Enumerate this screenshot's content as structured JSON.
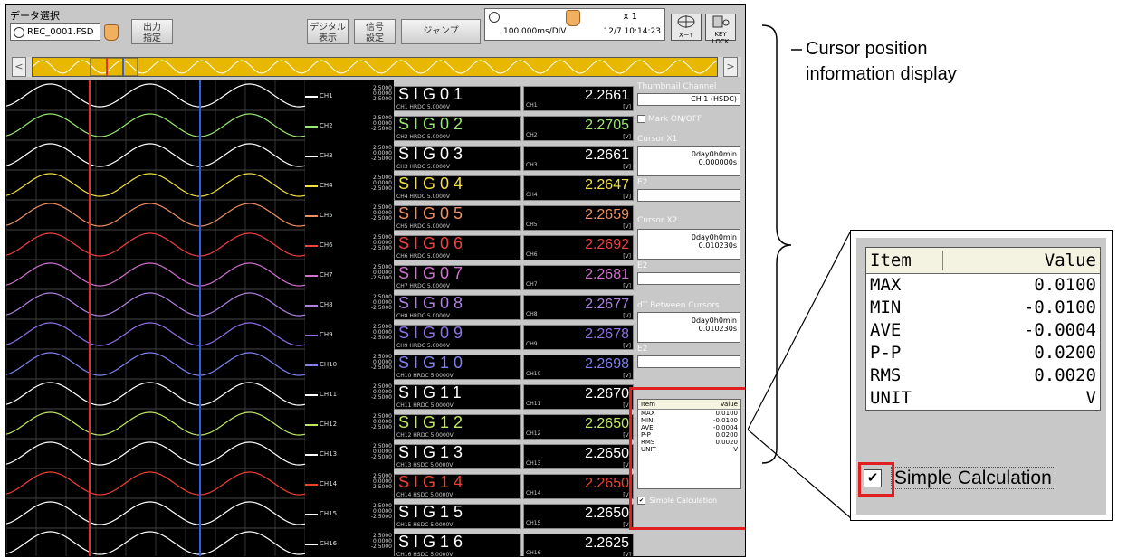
{
  "topbar": {
    "data_select_label": "データ選択",
    "file_name": "REC_0001.FSD",
    "output_btn": "出力\n指定",
    "digital_btn": "デジタル\n表示",
    "signal_btn": "信号\n設定",
    "jump_btn": "ジャンプ",
    "zoom_value": "x 1",
    "time_div": "100.000ms/DIV",
    "datetime": "12/7 10:14:23",
    "xy_label": "X－Y",
    "keylock_label": "KEY LOCK"
  },
  "channels": [
    {
      "ch": "CH1",
      "name": "SIG01",
      "sub": "CH1 HRDC 5.0000V",
      "value": "2.2661",
      "color": "#ffffff",
      "scale": [
        "2.5000",
        "0.0000",
        "-2.5000"
      ]
    },
    {
      "ch": "CH2",
      "name": "SIG02",
      "sub": "CH2 HRDC 5.0000V",
      "value": "2.2705",
      "color": "#98e870",
      "scale": [
        "2.5000",
        "0.0000",
        "-2.5000"
      ]
    },
    {
      "ch": "CH3",
      "name": "SIG03",
      "sub": "CH3 HRDC 5.0000V",
      "value": "2.2661",
      "color": "#ffffff",
      "scale": [
        "2.5000",
        "0.0000",
        "-2.5000"
      ]
    },
    {
      "ch": "CH4",
      "name": "SIG04",
      "sub": "CH4 HRDC 5.0000V",
      "value": "2.2647",
      "color": "#f0e040",
      "scale": [
        "2.5000",
        "0.0000",
        "-2.5000"
      ]
    },
    {
      "ch": "CH5",
      "name": "SIG05",
      "sub": "CH5 HRDC 5.0000V",
      "value": "2.2659",
      "color": "#f09060",
      "scale": [
        "2.5000",
        "0.0000",
        "-2.5000"
      ]
    },
    {
      "ch": "CH6",
      "name": "SIG06",
      "sub": "CH6 HRDC 5.0000V",
      "value": "2.2692",
      "color": "#f04040",
      "scale": [
        "2.5000",
        "0.0000",
        "-2.5000"
      ]
    },
    {
      "ch": "CH7",
      "name": "SIG07",
      "sub": "CH7 HRDC 5.0000V",
      "value": "2.2681",
      "color": "#d070d0",
      "scale": [
        "2.5000",
        "0.0000",
        "-2.5000"
      ]
    },
    {
      "ch": "CH8",
      "name": "SIG08",
      "sub": "CH8 HRDC 5.0000V",
      "value": "2.2677",
      "color": "#b080e0",
      "scale": [
        "2.5000",
        "0.0000",
        "-2.5000"
      ]
    },
    {
      "ch": "CH9",
      "name": "SIG09",
      "sub": "CH9 HRDC 5.0000V",
      "value": "2.2678",
      "color": "#9070e8",
      "scale": [
        "2.5000",
        "0.0000",
        "-2.5000"
      ]
    },
    {
      "ch": "CH10",
      "name": "SIG10",
      "sub": "CH10 HRDC 5.0000V",
      "value": "2.2698",
      "color": "#8080f0",
      "scale": [
        "2.5000",
        "0.0000",
        "-2.5000"
      ]
    },
    {
      "ch": "CH11",
      "name": "SIG11",
      "sub": "CH11 HRDC 5.0000V",
      "value": "2.2670",
      "color": "#ffffff",
      "scale": [
        "2.5000",
        "0.0000",
        "-2.5000"
      ]
    },
    {
      "ch": "CH12",
      "name": "SIG12",
      "sub": "CH12 HRDC 5.0000V",
      "value": "2.2650",
      "color": "#c0e860",
      "scale": [
        "2.5000",
        "0.0000",
        "-2.5000"
      ]
    },
    {
      "ch": "CH13",
      "name": "SIG13",
      "sub": "CH13 HSDC 5.0000V",
      "value": "2.2650",
      "color": "#ffffff",
      "scale": [
        "2.5000",
        "0.0000",
        "-2.5000"
      ]
    },
    {
      "ch": "CH14",
      "name": "SIG14",
      "sub": "CH14 HSDC 5.0000V",
      "value": "2.2650",
      "color": "#f04030",
      "scale": [
        "2.5000",
        "0.0000",
        "-2.5000"
      ]
    },
    {
      "ch": "CH15",
      "name": "SIG15",
      "sub": "CH15 HSDC 5.0000V",
      "value": "2.2650",
      "color": "#ffffff",
      "scale": [
        "2.5000",
        "0.0000",
        "-2.5000"
      ]
    },
    {
      "ch": "CH16",
      "name": "SIG16",
      "sub": "CH16 HSDC 5.0000V",
      "value": "2.2625",
      "color": "#ffffff",
      "scale": [
        "2.5000",
        "0.0000",
        "-2.5000"
      ]
    }
  ],
  "right_panel": {
    "thumbnail_label": "Thumbnail Channel",
    "thumbnail_value": "CH 1 (HSDC)",
    "mark_label": "Mark ON/OFF",
    "cursor1_label": "Cursor X1",
    "cursor1_line1": "0day0h0min",
    "cursor1_line2": "0.000000s",
    "e2_label": "E2",
    "cursor2_label": "Cursor X2",
    "cursor2_line1": "0day0h0min",
    "cursor2_line2": "0.010230s",
    "dt_label": "dT Between Cursors",
    "dt_line1": "0day0h0min",
    "dt_line2": "0.010230s",
    "unit_v": "[V]"
  },
  "calc": {
    "header_item": "Item",
    "header_value": "Value",
    "rows": [
      {
        "item": "MAX",
        "value": "0.0100"
      },
      {
        "item": "MIN",
        "value": "-0.0100"
      },
      {
        "item": "AVE",
        "value": "-0.0004"
      },
      {
        "item": "P-P",
        "value": "0.0200"
      },
      {
        "item": "RMS",
        "value": "0.0020"
      },
      {
        "item": "UNIT",
        "value": "V"
      }
    ],
    "checkbox_label": "Simple Calculation",
    "check_mark": "✔"
  },
  "annotation": {
    "line1": "Cursor position",
    "line2": "information display"
  },
  "colors": {
    "cursor1": "#e03030",
    "cursor2": "#3060e0",
    "highlight": "#e02020",
    "overview": "#e8b800"
  }
}
